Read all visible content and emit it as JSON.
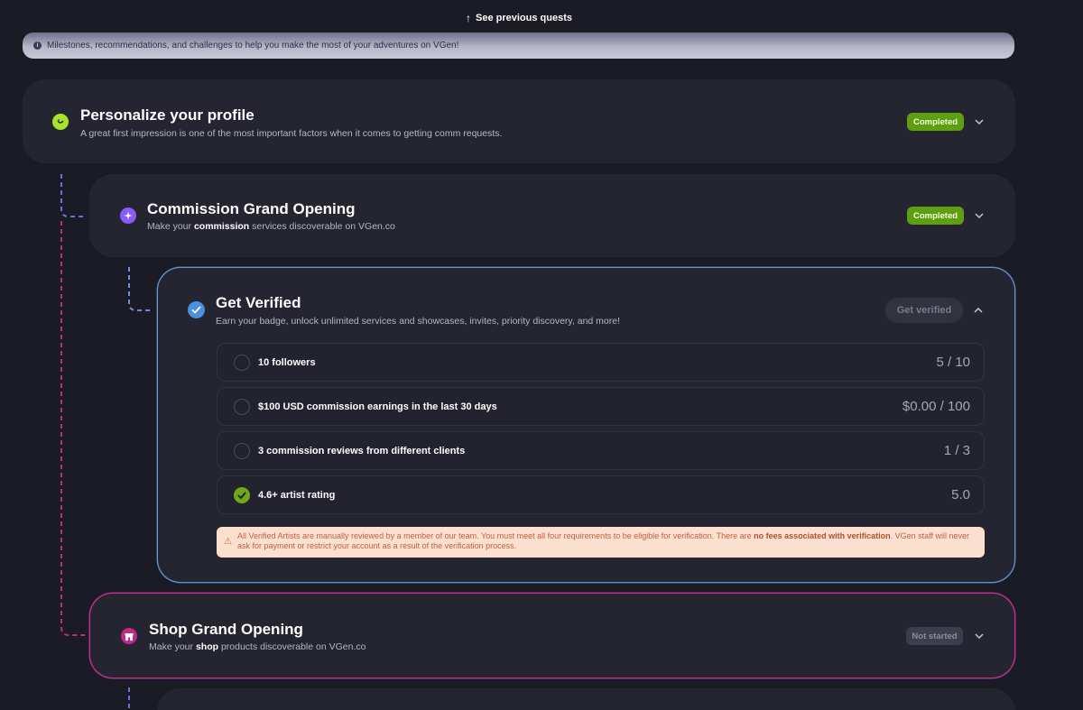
{
  "header": {
    "see_previous": "See previous quests",
    "info_text": "Milestones, recommendations, and challenges to help you make the most of your adventures on VGen!"
  },
  "quests": {
    "personalize": {
      "title": "Personalize your profile",
      "desc": "A great first impression is one of the most important factors when it comes to getting comm requests.",
      "status": "Completed",
      "icon_color": "#a6e22e"
    },
    "commission": {
      "title": "Commission Grand Opening",
      "desc_pre": "Make your ",
      "desc_bold": "commission",
      "desc_post": " services discoverable on VGen.co",
      "status": "Completed",
      "icon_color": "#8a5cf6"
    },
    "verified": {
      "title": "Get Verified",
      "desc": "Earn your badge, unlock unlimited services and showcases, invites, priority discovery, and more!",
      "button": "Get verified",
      "icon_color": "#4a90e2",
      "requirements": [
        {
          "label": "10 followers",
          "value": "5 / 10",
          "done": false
        },
        {
          "label": "$100 USD commission earnings in the last 30 days",
          "value": "$0.00 / 100",
          "done": false
        },
        {
          "label": "3 commission reviews from different clients",
          "value": "1 / 3",
          "done": false
        },
        {
          "label": "4.6+ artist rating",
          "value": "5.0",
          "done": true
        }
      ],
      "notice_pre": "All Verified Artists are manually reviewed by a member of our team. You must meet all four requirements to be eligible for verification. There are ",
      "notice_bold": "no fees associated with verification",
      "notice_post": ". VGen staff will never ask for payment or restrict your account as a result of the verification process."
    },
    "shop": {
      "title": "Shop Grand Opening",
      "desc_pre": "Make your ",
      "desc_bold": "shop",
      "desc_post": " products discoverable on VGen.co",
      "status": "Not started",
      "icon_color": "#c2288a"
    }
  },
  "colors": {
    "background": "#1b1b26",
    "card": "#252532",
    "completed": "#5e9f12",
    "verified_border": "#6a8fd8",
    "shop_border": "#d0307a",
    "notice_bg": "#fce0cf"
  }
}
